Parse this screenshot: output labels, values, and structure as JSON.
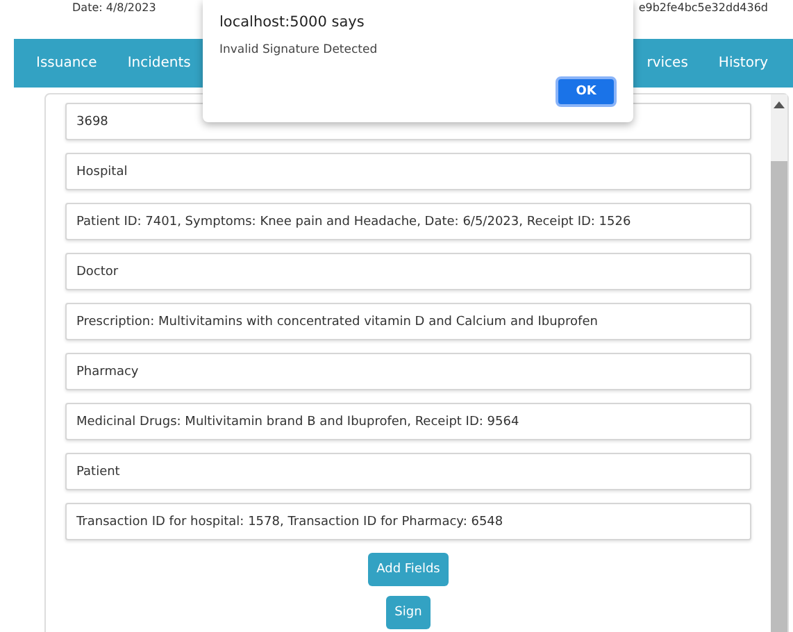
{
  "header": {
    "date": "Date: 4/8/2023",
    "hash": "e9b2fe4bc5e32dd436d"
  },
  "nav": {
    "tabs": [
      "Issuance",
      "Incidents"
    ],
    "trailing_tabs": [
      "rvices",
      "History"
    ]
  },
  "fields": [
    "3698",
    "Hospital",
    "Patient ID: 7401, Symptoms: Knee pain and Headache, Date: 6/5/2023, Receipt ID: 1526",
    "Doctor",
    "Prescription: Multivitamins with concentrated vitamin D and Calcium and Ibuprofen",
    "Pharmacy",
    "Medicinal Drugs: Multivitamin brand B and Ibuprofen, Receipt ID: 9564",
    "Patient",
    "Transaction ID for hospital: 1578, Transaction ID for Pharmacy: 6548"
  ],
  "buttons": [
    "Add Fields",
    "Sign"
  ],
  "dialog": {
    "title": "localhost:5000 says",
    "message": "Invalid Signature Detected",
    "button": "OK"
  }
}
